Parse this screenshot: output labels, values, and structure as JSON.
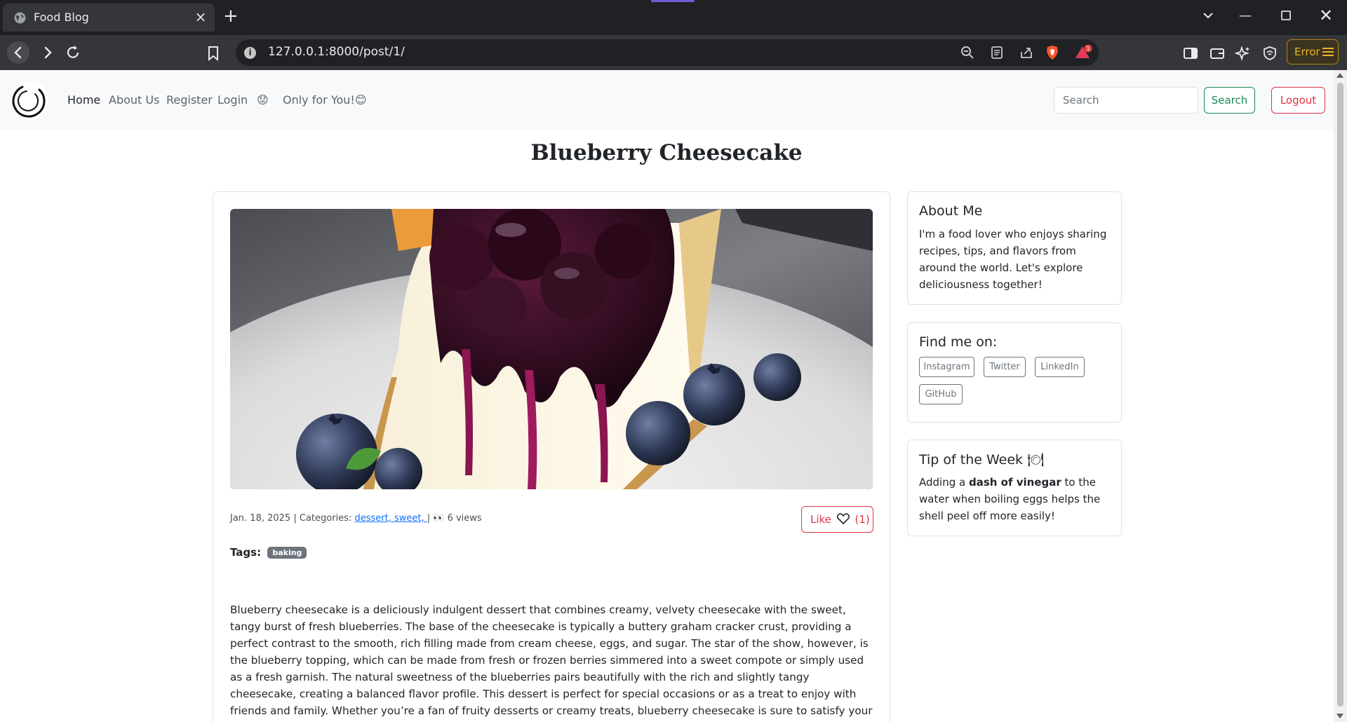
{
  "browser": {
    "tab_title": "Food Blog",
    "url": "127.0.0.1:8000/post/1/",
    "notification_count": "1",
    "error_label": "Error"
  },
  "nav": {
    "home": "Home",
    "about": "About Us",
    "register": "Register",
    "login": "Login",
    "emoji": "😟",
    "only_for_you": "Only for You!😊",
    "search_placeholder": "Search",
    "search_button": "Search",
    "logout_button": "Logout"
  },
  "post": {
    "title": "Blueberry Cheesecake",
    "date": "Jan. 18, 2025",
    "categories_label": "| Categories:",
    "categories": "dessert, sweet, ",
    "views_sep": "|",
    "views": "6 views",
    "like_label": "Like",
    "like_count": "(1)",
    "tags_label": "Tags:",
    "tags": [
      "baking"
    ],
    "body": "Blueberry cheesecake is a deliciously indulgent dessert that combines creamy, velvety cheesecake with the sweet, tangy burst of fresh blueberries. The base of the cheesecake is typically a buttery graham cracker crust, providing a perfect contrast to the smooth, rich filling made from cream cheese, eggs, and sugar. The star of the show, however, is the blueberry topping, which can be made from fresh or frozen berries simmered into a sweet compote or simply used as a fresh garnish. The natural sweetness of the blueberries pairs beautifully with the rich and slightly tangy cheesecake, creating a balanced flavor profile. This dessert is perfect for special occasions or as a treat to enjoy with friends and family. Whether you’re a fan of fruity desserts or creamy treats, blueberry cheesecake is sure to satisfy your sweet tooth and leave everyone craving more."
  },
  "sidebar": {
    "about_title": "About Me",
    "about_text": "I'm a food lover who enjoys sharing recipes, tips, and flavors from around the world. Let's explore deliciousness together!",
    "find_title": "Find me on:",
    "social": [
      "Instagram",
      "Twitter",
      "LinkedIn",
      "GitHub"
    ],
    "tip_title": "Tip of the Week 🍽",
    "tip_pre": "Adding a ",
    "tip_bold": "dash of vinegar",
    "tip_post": " to the water when boiling eggs helps the shell peel off more easily!"
  },
  "colors": {
    "success": "#198754",
    "danger": "#dc3545",
    "link": "#0d6efd",
    "badge": "#6c757d"
  }
}
